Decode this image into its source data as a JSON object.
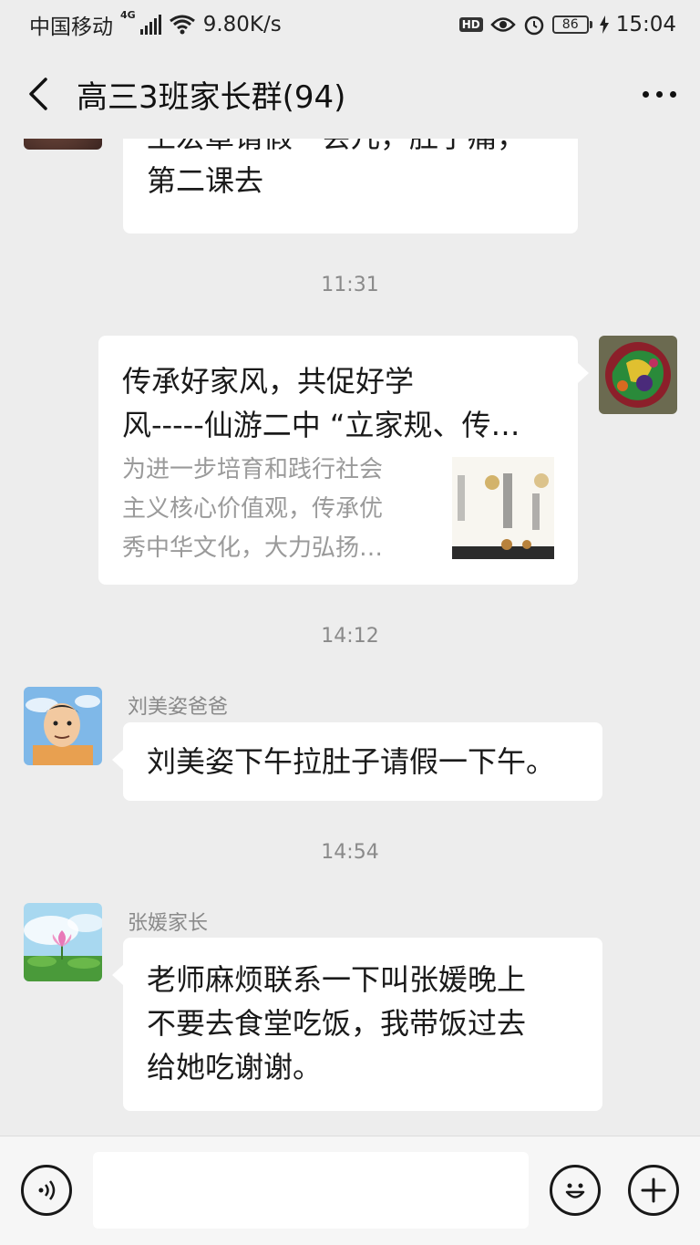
{
  "status_bar": {
    "carrier": "中国移动",
    "network_gen": "4G",
    "speed": "9.80K/s",
    "hd": "HD",
    "battery": "86",
    "time": "15:04"
  },
  "header": {
    "title": "高三3班家长群(94)",
    "back_icon": "chevron-left-icon",
    "more_icon": "more-dots-icon"
  },
  "messages": {
    "m0": {
      "text_line1": "王宏章请假一会儿，肚子痛，",
      "text_line2": "第二课去"
    },
    "t1": "11:31",
    "m1": {
      "title_line1": "传承好家风，共促好学",
      "title_line2": "风-----仙游二中 “立家规、传…",
      "desc_line1": "为进一步培育和践行社会",
      "desc_line2": "主义核心价值观，传承优",
      "desc_line3": "秀中华文化，大力弘扬…"
    },
    "t2": "14:12",
    "m2": {
      "sender": "刘美姿爸爸",
      "text": "刘美姿下午拉肚子请假一下午。"
    },
    "t3": "14:54",
    "m3": {
      "sender": "张媛家长",
      "text_line1": "老师麻烦联系一下叫张媛晚上",
      "text_line2": "不要去食堂吃饭，我带饭过去",
      "text_line3": "给她吃谢谢。"
    }
  },
  "input_bar": {
    "voice_icon": "voice-icon",
    "emoji_icon": "emoji-icon",
    "plus_icon": "plus-icon",
    "placeholder": ""
  },
  "colors": {
    "background": "#ededed",
    "bubble_in": "#ffffff",
    "timestamp": "#8a8a8a"
  }
}
